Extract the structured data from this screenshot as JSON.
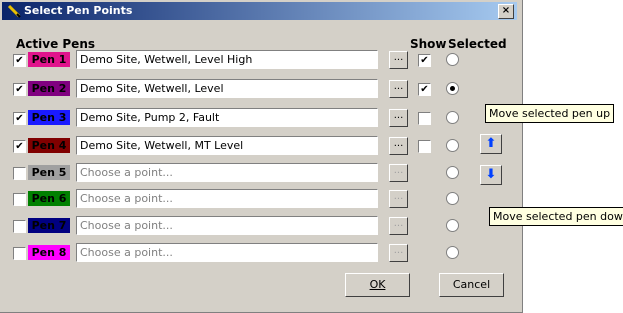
{
  "window": {
    "title": "Select Pen Points",
    "close_label": "×"
  },
  "headers": {
    "active_pens": "Active Pens",
    "show": "Show",
    "selected": "Selected"
  },
  "pens": [
    {
      "label": "Pen 1",
      "checked": true,
      "color": "#e0148c",
      "text_color": "#000000",
      "value": "Demo Site, Wetwell, Level High",
      "is_placeholder": false,
      "show": true,
      "has_show": true,
      "selected": false
    },
    {
      "label": "Pen 2",
      "checked": true,
      "color": "#800080",
      "text_color": "#000000",
      "value": "Demo Site, Wetwell, Level",
      "is_placeholder": false,
      "show": true,
      "has_show": true,
      "selected": true
    },
    {
      "label": "Pen 3",
      "checked": true,
      "color": "#1a1aff",
      "text_color": "#000000",
      "value": "Demo Site, Pump 2, Fault",
      "is_placeholder": false,
      "show": false,
      "has_show": true,
      "selected": false
    },
    {
      "label": "Pen 4",
      "checked": true,
      "color": "#800000",
      "text_color": "#000000",
      "value": "Demo Site, Wetwell, MT Level",
      "is_placeholder": false,
      "show": false,
      "has_show": true,
      "selected": false
    },
    {
      "label": "Pen 5",
      "checked": false,
      "color": "#a0a0a0",
      "text_color": "#000000",
      "value": "Choose a point...",
      "is_placeholder": true,
      "show": false,
      "has_show": false,
      "selected": false
    },
    {
      "label": "Pen 6",
      "checked": false,
      "color": "#008000",
      "text_color": "#000000",
      "value": "Choose a point...",
      "is_placeholder": true,
      "show": false,
      "has_show": false,
      "selected": false
    },
    {
      "label": "Pen 7",
      "checked": false,
      "color": "#000080",
      "text_color": "#000000",
      "value": "Choose a point...",
      "is_placeholder": true,
      "show": false,
      "has_show": false,
      "selected": false
    },
    {
      "label": "Pen 8",
      "checked": false,
      "color": "#ff00ff",
      "text_color": "#000000",
      "value": "Choose a point...",
      "is_placeholder": true,
      "show": false,
      "has_show": false,
      "selected": false
    }
  ],
  "browse_label": "...",
  "move_up_icon": "up-arrow-icon",
  "move_down_icon": "down-arrow-icon",
  "tooltips": {
    "up": "Move selected pen up",
    "down": "Move selected pen down"
  },
  "buttons": {
    "ok": "OK",
    "cancel": "Cancel"
  }
}
